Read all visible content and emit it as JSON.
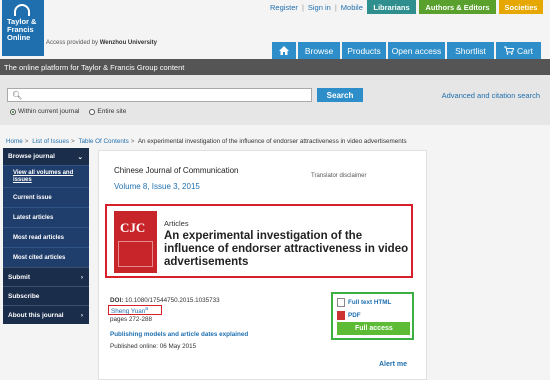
{
  "header": {
    "brand_line1": "Taylor &",
    "brand_line2": "Francis",
    "brand_line3": "Online",
    "access_prefix": "Access provided by",
    "access_institution": "Wenzhou University",
    "toplinks": [
      "Register",
      "Sign in",
      "Mobile"
    ],
    "pills": {
      "librarians": "Librarians",
      "authors": "Authors & Editors",
      "societies": "Societies"
    },
    "nav": {
      "browse": "Browse",
      "products": "Products",
      "open_access": "Open access",
      "shortlist": "Shortlist",
      "cart": "Cart"
    },
    "tagline": "The online platform for Taylor & Francis Group content"
  },
  "search": {
    "button": "Search",
    "radio_current": "Within current journal",
    "radio_entire": "Entire site",
    "advanced": "Advanced and citation search"
  },
  "breadcrumb": [
    "Home",
    "List of Issues",
    "Table Of Contents"
  ],
  "breadcrumb_current": "An experimental investigation of the influence of endorser attractiveness in video advertisements",
  "sidebar": {
    "browse_journal": "Browse journal",
    "items": [
      "View all volumes and issues",
      "Current issue",
      "Latest articles",
      "Most read articles",
      "Most cited articles"
    ],
    "submit": "Submit",
    "subscribe": "Subscribe",
    "about": "About this journal"
  },
  "article": {
    "journal": "Chinese Journal of Communication",
    "issue": "Volume 8, Issue 3, 2015",
    "translator": "Translator disclaimer",
    "section": "Articles",
    "title": "An experimental investigation of the influence of endorser attractiveness in video advertisements",
    "doi_label": "DOI:",
    "doi": "10.1080/17544750.2015.1035733",
    "author": "Sheng Yuan",
    "pages": "pages 272-288",
    "pub_models": "Publishing models and article dates explained",
    "published": "Published online: 06 May 2015",
    "alert": "Alert me",
    "full_text_html": "Full text HTML",
    "pdf": "PDF",
    "full_access": "Full access"
  },
  "colors": {
    "brand_blue": "#1f6fae",
    "nav_blue": "#2d8ec9",
    "sidebar_dark": "#1a2d4b",
    "highlight_red": "#d8202b",
    "access_green": "#5dbb36"
  }
}
